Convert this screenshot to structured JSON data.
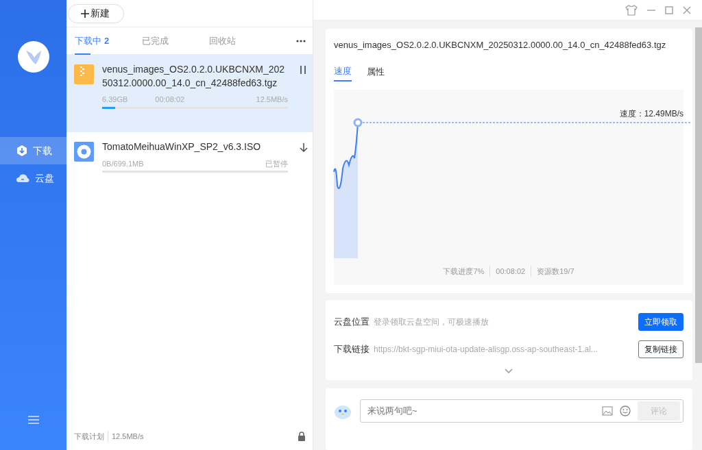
{
  "new_button": {
    "label": "新建"
  },
  "sidebar": {
    "items": [
      {
        "label": "下载",
        "kind": "download",
        "selected": true
      },
      {
        "label": "云盘",
        "kind": "cloud",
        "selected": false
      }
    ]
  },
  "tabs": [
    {
      "label": "下载中",
      "count": "2",
      "selected": true
    },
    {
      "label": "已完成",
      "selected": false
    },
    {
      "label": "回收站",
      "selected": false
    }
  ],
  "downloads": [
    {
      "kind": "archive",
      "name": "venus_images_OS2.0.2.0.UKBCNXM_20250312.0000.00_14.0_cn_42488fed63.tgz",
      "size": "6.39GB",
      "time": "00:08:02",
      "status": "12.5MB/s",
      "level": 0.07,
      "paused": false,
      "selected": true
    },
    {
      "kind": "disc",
      "name": "TomatoMeihuaWinXP_SP2_v6.3.ISO",
      "size": "0B/699.1MB",
      "status": "已暂停",
      "level": 0,
      "paused": true,
      "selected": false
    }
  ],
  "footer": {
    "label": "下载计划",
    "speed": "12.5MB/s"
  },
  "detail": {
    "title": "venus_images_OS2.0.2.0.UKBCNXM_20250312.0000.00_14.0_cn_42488fed63.tgz",
    "tabs": [
      {
        "label": "速度",
        "selected": true
      },
      {
        "label": "属性",
        "selected": false
      }
    ],
    "speed_reading": "速度：12.49MB/s",
    "stats": [
      "下载进度7%",
      "00:08:02",
      "资源数19/7"
    ]
  },
  "cloud": {
    "rows": [
      {
        "label": "云盘位置",
        "value": "登录领取云盘空间，可极速播放",
        "button": "立即领取",
        "kind": "primary"
      },
      {
        "label": "下载链接",
        "value": "https://bkt-sgp-miui-ota-update-alisgp.oss-ap-southeast-1.al...",
        "button": "复制链接",
        "kind": "outline"
      }
    ]
  },
  "comment": {
    "placeholder": "来说两句吧~",
    "submit": "评论",
    "submit_disabled": true
  }
}
